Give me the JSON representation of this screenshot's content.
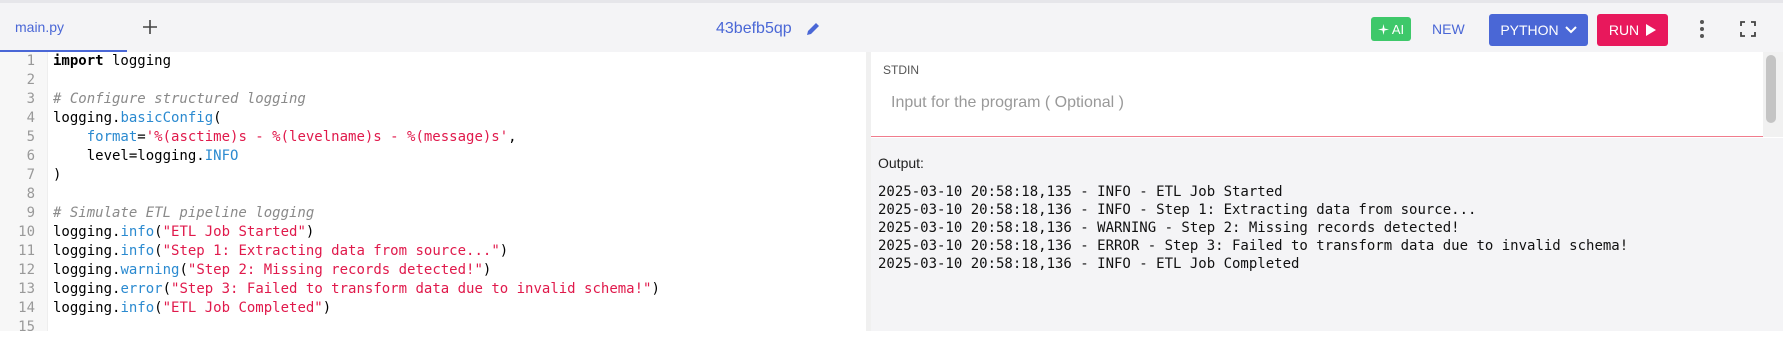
{
  "tab": {
    "label": "main.py"
  },
  "header": {
    "title": "43befb5qp"
  },
  "toolbar": {
    "ai_label": "AI",
    "new_label": "NEW",
    "language_label": "PYTHON",
    "run_label": "RUN"
  },
  "editor": {
    "line_numbers": [
      "1",
      "2",
      "3",
      "4",
      "5",
      "6",
      "7",
      "8",
      "9",
      "10",
      "11",
      "12",
      "13",
      "14",
      "15"
    ]
  },
  "stdin": {
    "label": "STDIN",
    "placeholder": "Input for the program ( Optional )"
  },
  "output": {
    "label": "Output:",
    "lines": [
      "2025-03-10 20:58:18,135 - INFO - ETL Job Started",
      "2025-03-10 20:58:18,136 - INFO - Step 1: Extracting data from source...",
      "2025-03-10 20:58:18,136 - WARNING - Step 2: Missing records detected!",
      "2025-03-10 20:58:18,136 - ERROR - Step 3: Failed to transform data due to invalid schema!",
      "2025-03-10 20:58:18,136 - INFO - ETL Job Completed"
    ]
  },
  "colors": {
    "accent": "#4a67d6",
    "run": "#e8185c",
    "ai": "#3ec86a",
    "string": "#e0194b",
    "function": "#2b8ad0",
    "comment": "#8a8a8a"
  },
  "code": {
    "l1_kw": "import",
    "l1_rest": " logging",
    "l3": "# Configure structured logging",
    "l4_a": "logging.",
    "l4_fn": "basicConfig",
    "l4_b": "(",
    "l5_indent": "    ",
    "l5_fn": "format",
    "l5_eq": "=",
    "l5_str": "'%(asctime)s - %(levelname)s - %(message)s'",
    "l5_end": ",",
    "l6_a": "    level=logging.",
    "l6_fn": "INFO",
    "l7": ")",
    "l9": "# Simulate ETL pipeline logging",
    "l10_a": "logging.",
    "l10_fn": "info",
    "l10_b": "(",
    "l10_str": "\"ETL Job Started\"",
    "l10_c": ")",
    "l11_a": "logging.",
    "l11_fn": "info",
    "l11_b": "(",
    "l11_str": "\"Step 1: Extracting data from source...\"",
    "l11_c": ")",
    "l12_a": "logging.",
    "l12_fn": "warning",
    "l12_b": "(",
    "l12_str": "\"Step 2: Missing records detected!\"",
    "l12_c": ")",
    "l13_a": "logging.",
    "l13_fn": "error",
    "l13_b": "(",
    "l13_str": "\"Step 3: Failed to transform data due to invalid schema!\"",
    "l13_c": ")",
    "l14_a": "logging.",
    "l14_fn": "info",
    "l14_b": "(",
    "l14_str": "\"ETL Job Completed\"",
    "l14_c": ")"
  }
}
